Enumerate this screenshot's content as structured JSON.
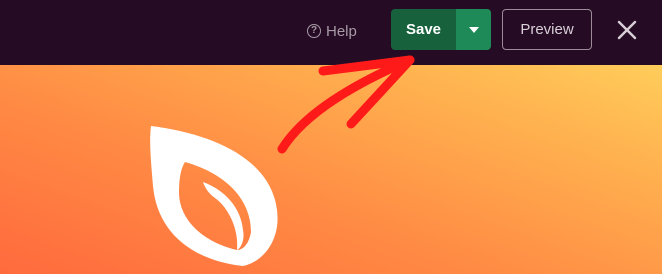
{
  "toolbar": {
    "help_label": "Help",
    "help_icon": "question-circle-icon",
    "save_label": "Save",
    "save_dropdown_icon": "caret-down-icon",
    "preview_label": "Preview",
    "close_icon": "close-icon"
  },
  "colors": {
    "topbar_bg": "#250c24",
    "save_bg": "#17623d",
    "save_dropdown_bg": "#1d8a57",
    "annotation_arrow": "#ff1a1a",
    "logo_fill": "#ffffff"
  },
  "canvas": {
    "logo_icon": "leaf-logo-icon",
    "annotation_icon": "arrow-pointer-icon"
  }
}
